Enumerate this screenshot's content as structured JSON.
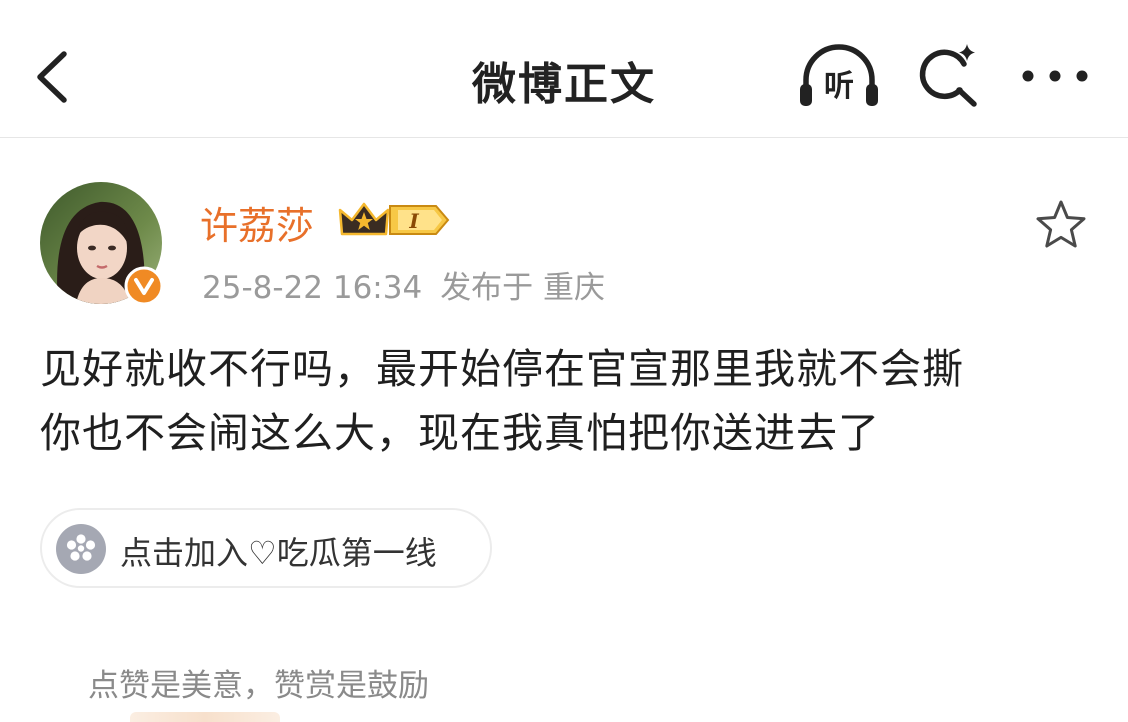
{
  "header": {
    "title": "微博正文",
    "listen_label": "听",
    "icons": [
      "back-arrow-icon",
      "headphones-icon",
      "sparkle-search-icon",
      "more-dots-icon"
    ]
  },
  "post": {
    "author": {
      "name": "许荔莎",
      "vip_level": "I",
      "verified_icon": "v-verified-icon"
    },
    "timestamp": "25-8-22 16:34",
    "location": "发布于 重庆",
    "content_lines": [
      "见好就收不行吗，最开始停在官宣那里我就不会撕",
      "你也不会闹这么大，现在我真怕把你送进去了"
    ],
    "topic": {
      "label": "点击加入♡吃瓜第一线"
    }
  },
  "reward": {
    "prompt": "点赞是美意，赞赏是鼓励"
  },
  "colors": {
    "author_name": "#e8702a",
    "verified_badge": "#f08a24",
    "vip_gold": "#f5b82e",
    "meta_text": "#9a9a9a",
    "text_primary": "#1f1f1f"
  }
}
